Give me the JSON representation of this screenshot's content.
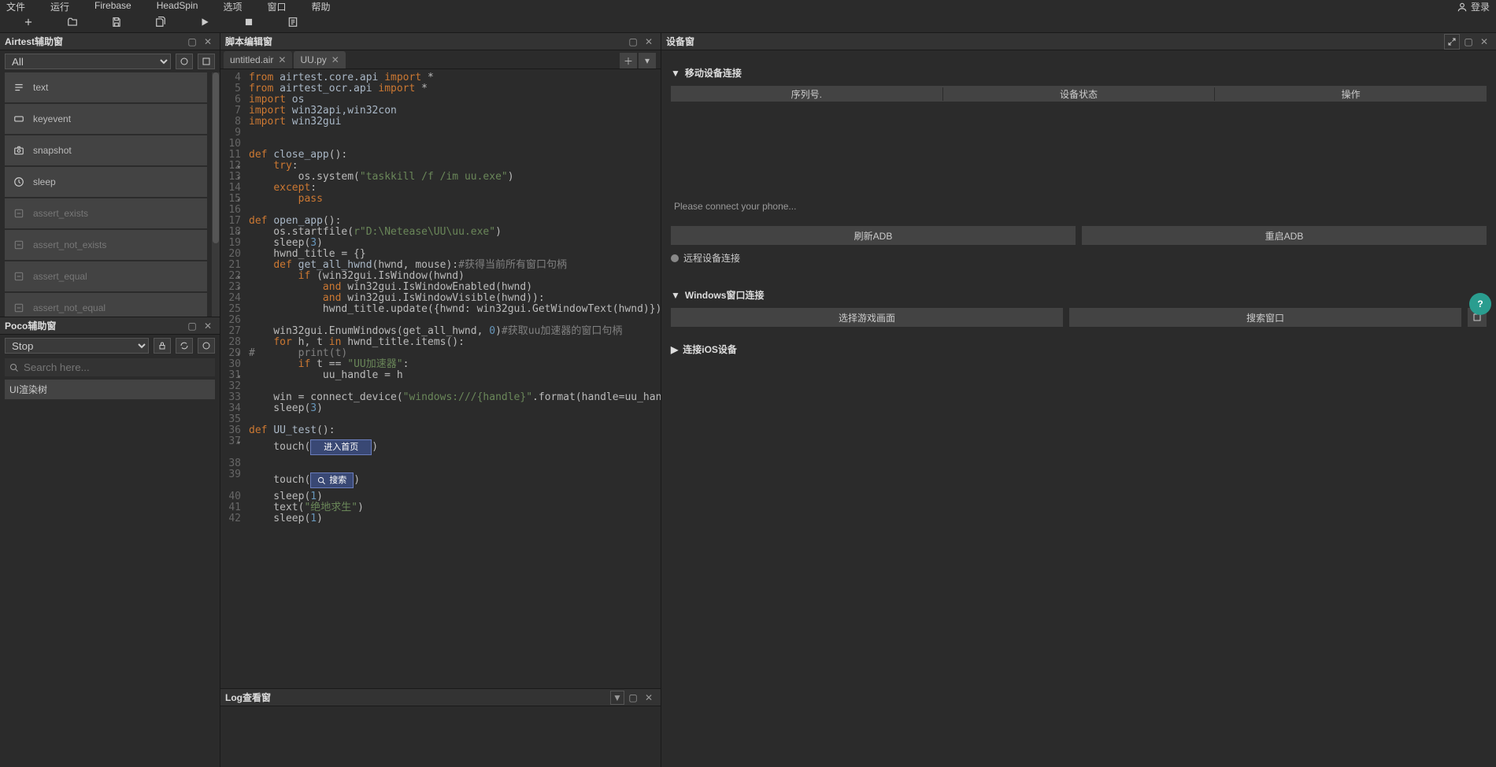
{
  "menu": {
    "items": [
      "文件",
      "运行",
      "Firebase",
      "HeadSpin",
      "选项",
      "窗口",
      "帮助"
    ],
    "login": "登录"
  },
  "panels": {
    "airtest": {
      "title": "Airtest辅助窗",
      "filter_value": "All",
      "items": [
        {
          "label": "text",
          "dim": false
        },
        {
          "label": "keyevent",
          "dim": false
        },
        {
          "label": "snapshot",
          "dim": false
        },
        {
          "label": "sleep",
          "dim": false
        },
        {
          "label": "assert_exists",
          "dim": true
        },
        {
          "label": "assert_not_exists",
          "dim": true
        },
        {
          "label": "assert_equal",
          "dim": true
        },
        {
          "label": "assert_not_equal",
          "dim": true
        }
      ]
    },
    "poco": {
      "title": "Poco辅助窗",
      "mode": "Stop",
      "search_placeholder": "Search here...",
      "tree_label": "UI渲染树"
    },
    "editor": {
      "title": "脚本编辑窗",
      "tabs": [
        {
          "label": "untitled.air"
        },
        {
          "label": "UU.py"
        }
      ],
      "active_tab": 1,
      "lines": {
        "4": {
          "html": "<span class='kw'>from</span> <span class='fn'>airtest.core.api</span> <span class='kw'>import</span> *"
        },
        "5": {
          "html": "<span class='kw'>from</span> <span class='fn'>airtest_ocr.api</span> <span class='kw'>import</span> *"
        },
        "6": {
          "html": "<span class='kw'>import</span> <span class='fn'>os</span>"
        },
        "7": {
          "html": "<span class='kw'>import</span> <span class='fn'>win32api,win32con</span>"
        },
        "8": {
          "html": "<span class='kw'>import</span> <span class='fn'>win32gui</span>"
        },
        "9": {
          "html": ""
        },
        "10": {
          "html": ""
        },
        "11": {
          "html": "<span class='kw'>def</span> <span class='fn'>close_app</span>():",
          "fold": true
        },
        "12": {
          "html": "    <span class='kw'>try</span>:",
          "fold": true
        },
        "13": {
          "html": "        os.system(<span class='str'>\"taskkill /f /im uu.exe\"</span>)"
        },
        "14": {
          "html": "    <span class='kw'>except</span>:",
          "fold": true
        },
        "15": {
          "html": "        <span class='kw'>pass</span>"
        },
        "16": {
          "html": ""
        },
        "17": {
          "html": "<span class='kw'>def</span> <span class='fn'>open_app</span>():",
          "fold": true
        },
        "18": {
          "html": "    os.startfile(<span class='str'>r\"D:\\Netease\\UU\\uu.exe\"</span>)"
        },
        "19": {
          "html": "    sleep(<span class='num'>3</span>)"
        },
        "20": {
          "html": "    hwnd_title = {}"
        },
        "21": {
          "html": "    <span class='kw'>def</span> <span class='fn'>get_all_hwnd</span>(hwnd, mouse):<span class='cm'>#获得当前所有窗口句柄</span>",
          "fold": true
        },
        "22": {
          "html": "        <span class='kw'>if</span> (win32gui.IsWindow(hwnd)",
          "fold": true
        },
        "23": {
          "html": "            <span class='kw'>and</span> win32gui.IsWindowEnabled(hwnd)"
        },
        "24": {
          "html": "            <span class='kw'>and</span> win32gui.IsWindowVisible(hwnd)):"
        },
        "25": {
          "html": "            hwnd_title.update({hwnd: win32gui.GetWindowText(hwnd)})"
        },
        "26": {
          "html": ""
        },
        "27": {
          "html": "    win32gui.EnumWindows(get_all_hwnd, <span class='num'>0</span>)<span class='cm'>#获取uu加速器的窗口句柄</span>"
        },
        "28": {
          "html": "    <span class='kw'>for</span> h, t <span class='kw'>in</span> hwnd_title.items():",
          "fold": true
        },
        "29": {
          "html": "<span class='cm'>#       print(t)</span>"
        },
        "30": {
          "html": "        <span class='kw'>if</span> t == <span class='str'>\"UU加速器\"</span>:",
          "fold": true
        },
        "31": {
          "html": "            uu_handle = h"
        },
        "32": {
          "html": ""
        },
        "33": {
          "html": "    win = connect_device(<span class='str'>\"windows:///{handle}\"</span>.format(handle=uu_handle))<span class='cm'>#连接窗口</span>"
        },
        "34": {
          "html": "    sleep(<span class='num'>3</span>)"
        },
        "35": {
          "html": ""
        },
        "36": {
          "html": "<span class='kw'>def</span> <span class='fn'>UU_test</span>():",
          "fold": true
        },
        "37": {
          "html": "",
          "embed": "进入首页",
          "embed_prefix": "    touch("
        },
        "38": {
          "html": ""
        },
        "39": {
          "html": "",
          "embed": "搜索",
          "embed_search": true,
          "embed_prefix": "    touch("
        },
        "40": {
          "html": "    sleep(<span class='num'>1</span>)"
        },
        "41": {
          "html": "    text(<span class='str'>\"绝地求生\"</span>)"
        },
        "42": {
          "html": "    sleep(<span class='num'>1</span>)"
        }
      },
      "line_start": 4,
      "line_end": 42
    },
    "log": {
      "title": "Log查看窗"
    },
    "device": {
      "title": "设备窗",
      "mobile_section": "移动设备连接",
      "table_headers": [
        "序列号.",
        "设备状态",
        "操作"
      ],
      "empty_msg": "Please connect your phone...",
      "refresh_adb": "刷新ADB",
      "restart_adb": "重启ADB",
      "remote_label": "远程设备连接",
      "windows_section": "Windows窗口连接",
      "select_game": "选择游戏画面",
      "search_window": "搜索窗口",
      "ios_section": "连接iOS设备"
    }
  }
}
